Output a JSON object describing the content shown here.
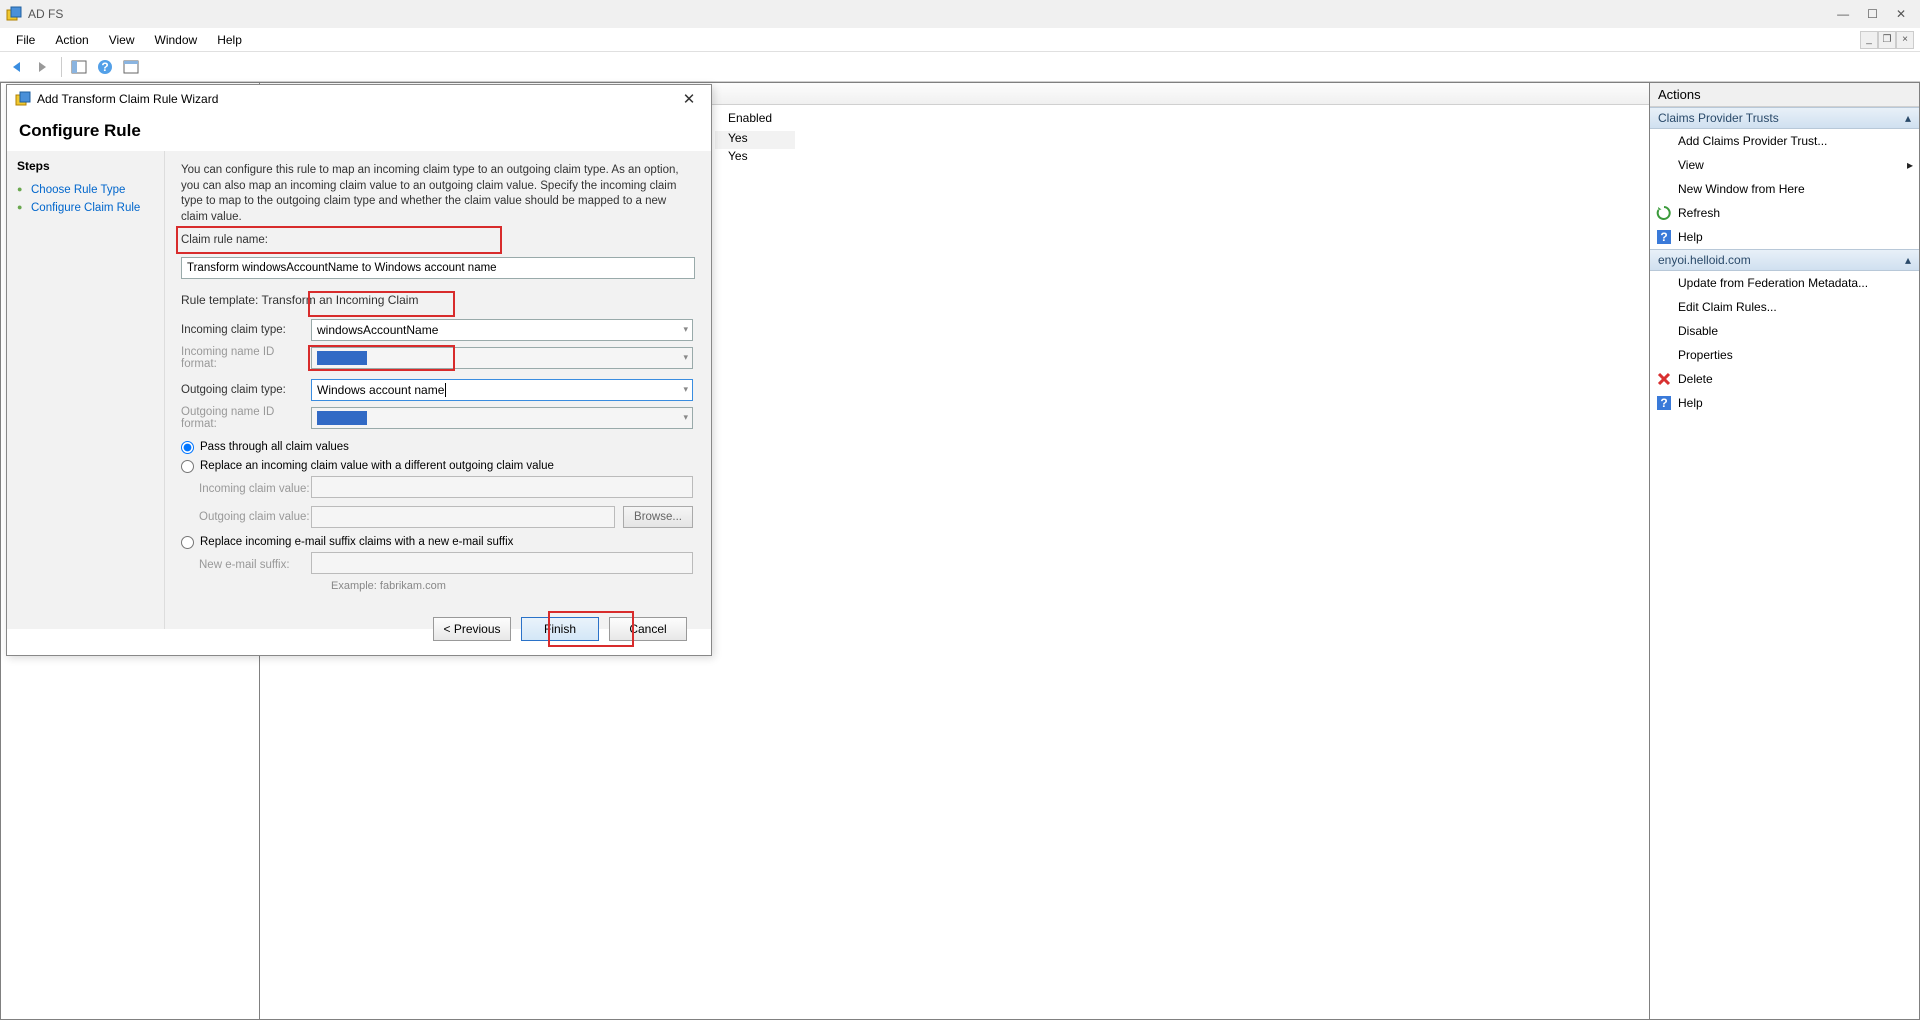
{
  "app": {
    "title": "AD FS"
  },
  "menubar": {
    "file": "File",
    "action": "Action",
    "view": "View",
    "window": "Window",
    "help": "Help"
  },
  "main": {
    "enabled_header": "Enabled",
    "rows": [
      {
        "enabled": "Yes"
      },
      {
        "enabled": "Yes"
      }
    ]
  },
  "actions": {
    "title": "Actions",
    "group1": {
      "header": "Claims Provider Trusts",
      "items": [
        {
          "label": "Add Claims Provider Trust..."
        },
        {
          "label": "View",
          "chevron": true
        },
        {
          "label": "New Window from Here"
        },
        {
          "label": "Refresh",
          "icon": "refresh"
        },
        {
          "label": "Help",
          "icon": "help"
        }
      ]
    },
    "group2": {
      "header": "enyoi.helloid.com",
      "items": [
        {
          "label": "Update from Federation Metadata..."
        },
        {
          "label": "Edit Claim Rules..."
        },
        {
          "label": "Disable"
        },
        {
          "label": "Properties"
        },
        {
          "label": "Delete",
          "icon": "delete"
        },
        {
          "label": "Help",
          "icon": "help"
        }
      ]
    }
  },
  "dialog": {
    "title": "Add Transform Claim Rule Wizard",
    "header": "Configure Rule",
    "steps": {
      "title": "Steps",
      "items": [
        "Choose Rule Type",
        "Configure Claim Rule"
      ]
    },
    "intro": "You can configure this rule to map an incoming claim type to an outgoing claim type. As an option, you can also map an incoming claim value to an outgoing claim value. Specify the incoming claim type to map to the outgoing claim type and whether the claim value should be mapped to a new claim value.",
    "labels": {
      "rule_name": "Claim rule name:",
      "rule_template_prefix": "Rule template: ",
      "rule_template": "Transform an Incoming Claim",
      "incoming_type": "Incoming claim type:",
      "incoming_nameid": "Incoming name ID format:",
      "outgoing_type": "Outgoing claim type:",
      "outgoing_nameid": "Outgoing name ID format:",
      "radio_passthrough": "Pass through all claim values",
      "radio_replace": "Replace an incoming claim value with a different outgoing claim value",
      "incoming_value": "Incoming claim value:",
      "outgoing_value": "Outgoing claim value:",
      "browse": "Browse...",
      "radio_suffix": "Replace incoming e-mail suffix claims with a new e-mail suffix",
      "new_suffix": "New e-mail suffix:",
      "example": "Example: fabrikam.com"
    },
    "values": {
      "rule_name": "Transform windowsAccountName to Windows account name",
      "incoming_type": "windowsAccountName",
      "outgoing_type": "Windows account name"
    },
    "buttons": {
      "previous": "< Previous",
      "finish": "Finish",
      "cancel": "Cancel"
    }
  }
}
